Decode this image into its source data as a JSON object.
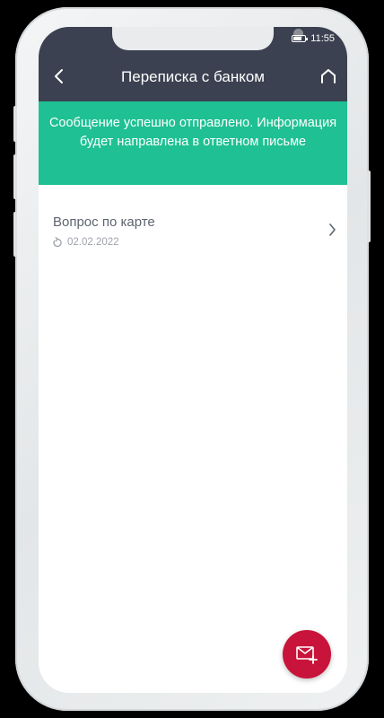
{
  "status_bar": {
    "time": "11:55"
  },
  "header": {
    "title": "Переписка с банком",
    "back_icon": "chevron-left-icon",
    "home_icon": "home-icon"
  },
  "banner": {
    "message": "Сообщение успешно отправлено. Информация будет направлена в ответном письме",
    "color": "#1fc093"
  },
  "messages": [
    {
      "title": "Вопрос по карте",
      "date": "02.02.2022",
      "status_icon": "refresh-icon"
    }
  ],
  "fab": {
    "icon": "new-message-icon",
    "color": "#c8143a"
  },
  "colors": {
    "header_bg": "#3b4150",
    "accent_green": "#1fc093",
    "accent_red": "#c8143a"
  }
}
